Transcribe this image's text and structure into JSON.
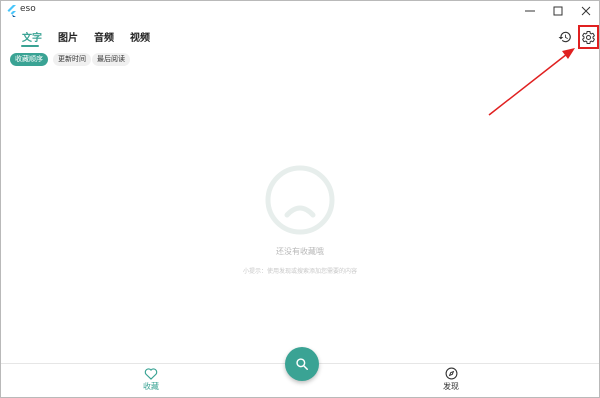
{
  "window": {
    "title": "eso",
    "controls": [
      "minimize",
      "maximize",
      "close"
    ]
  },
  "tabs": [
    {
      "label": "文字",
      "active": true
    },
    {
      "label": "图片",
      "active": false
    },
    {
      "label": "音频",
      "active": false
    },
    {
      "label": "视频",
      "active": false
    }
  ],
  "toolbar": {
    "history_icon": "history-icon",
    "settings_icon": "gear-icon"
  },
  "sort_chips": [
    {
      "label": "收藏顺序",
      "active": true
    },
    {
      "label": "更新时间",
      "active": false
    },
    {
      "label": "最后阅读",
      "active": false
    }
  ],
  "empty_state": {
    "icon": "sad-face-icon",
    "title": "还没有收藏哦",
    "hint": "小提示：使用发现或搜索添加您需要的内容"
  },
  "bottom_nav": {
    "favorites_label": "收藏",
    "search_icon": "search-icon",
    "discover_label": "发现"
  },
  "colors": {
    "accent": "#3aa394",
    "annotation": "#e02020"
  }
}
